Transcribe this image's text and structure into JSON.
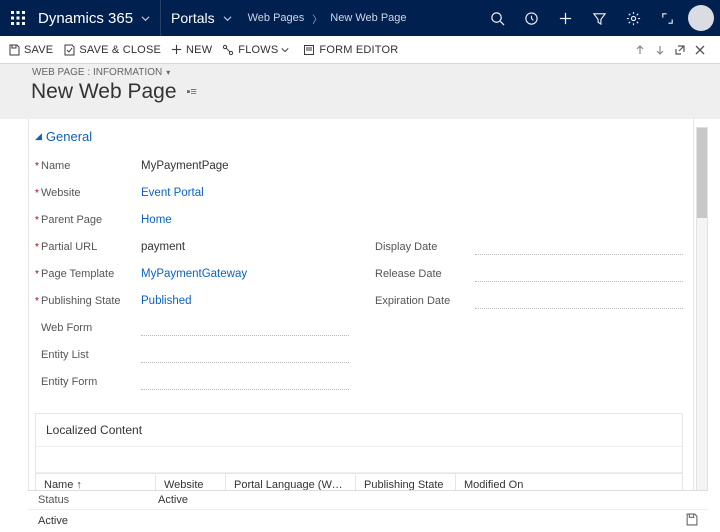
{
  "nav": {
    "app": "Dynamics 365",
    "area": "Portals",
    "breadcrumb": [
      "Web Pages",
      "New Web Page"
    ]
  },
  "commands": {
    "save": "SAVE",
    "saveclose": "SAVE & CLOSE",
    "new": "NEW",
    "flows": "FLOWS",
    "formeditor": "FORM EDITOR"
  },
  "header": {
    "recordtype": "WEB PAGE : INFORMATION",
    "title": "New Web Page"
  },
  "section": {
    "general": "General"
  },
  "fields": {
    "name_label": "Name",
    "name": "MyPaymentPage",
    "website_label": "Website",
    "website": "Event Portal",
    "parent_label": "Parent Page",
    "parent": "Home",
    "partialurl_label": "Partial URL",
    "partialurl": "payment",
    "template_label": "Page Template",
    "template": "MyPaymentGateway",
    "pubstate_label": "Publishing State",
    "pubstate": "Published",
    "webform_label": "Web Form",
    "entitylist_label": "Entity List",
    "entityform_label": "Entity Form",
    "displaydate_label": "Display Date",
    "releasedate_label": "Release Date",
    "expdate_label": "Expiration Date"
  },
  "subgrid": {
    "title": "Localized Content",
    "cols": [
      "Name ↑",
      "Website",
      "Portal Language (Webpage Lang...",
      "Publishing State",
      "Modified On"
    ]
  },
  "footer": {
    "status_label": "Status",
    "status": "Active",
    "active": "Active"
  }
}
